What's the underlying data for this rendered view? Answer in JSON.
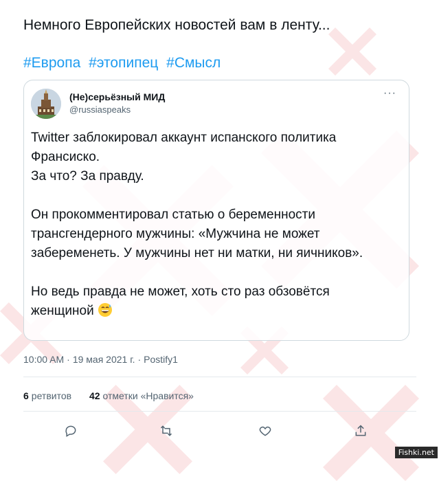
{
  "post": {
    "text": "Немного Европейских новостей вам в ленту...",
    "hashtags": [
      "#Европа",
      "#этопипец",
      "#Смысл"
    ]
  },
  "quote": {
    "author_name": "(Не)серьёзный МИД",
    "author_handle": "@russiaspeaks",
    "more": "···",
    "paragraphs": [
      "Twitter заблокировал аккаунт испанского политика Франсиско.",
      "За что? За правду.",
      "Он прокомментировал статью о беременности трансгендерного мужчины: «Мужчина не может забеременеть. У мужчины нет ни матки, ни яичников».",
      "Но ведь правда не может, хоть сто раз обзовётся женщиной"
    ],
    "emoji_icon": "grinning-sweat-emoji"
  },
  "meta": {
    "time": "10:00 AM",
    "sep": "·",
    "date": "19 мая 2021 г.",
    "source": "Postify1"
  },
  "stats": {
    "retweets_count": "6",
    "retweets_label": "ретвитов",
    "likes_count": "42",
    "likes_label": "отметки «Нравится»"
  },
  "actions": [
    "reply-icon",
    "retweet-icon",
    "like-icon",
    "share-icon"
  ],
  "watermark": {
    "credit": "Fishki.net",
    "color": "#e0303a"
  },
  "colors": {
    "link": "#1d9bf0",
    "muted": "#536471",
    "text": "#0f1419"
  }
}
